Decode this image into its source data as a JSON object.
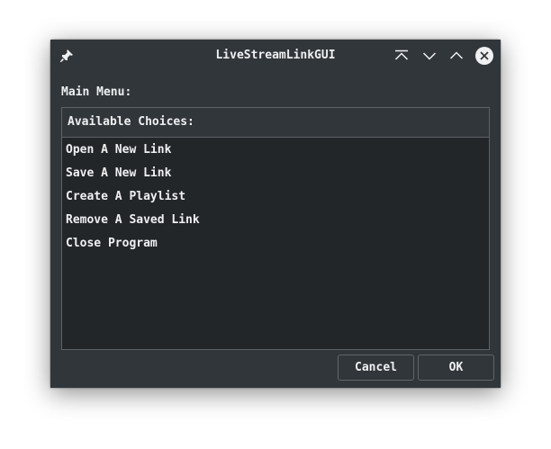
{
  "window": {
    "title": "LiveStreamLinkGUI"
  },
  "titlebar_icons": [
    "pin-icon",
    "keep-above-icon",
    "minimize-icon",
    "maximize-icon",
    "close-icon"
  ],
  "main": {
    "label": "Main Menu:",
    "list_header": "Available Choices:",
    "items": [
      "Open A New Link",
      "Save A New Link",
      "Create A Playlist",
      "Remove A Saved Link",
      "Close Program"
    ]
  },
  "buttons": {
    "cancel": "Cancel",
    "ok": "OK"
  },
  "colors": {
    "window_bg": "#31363b",
    "list_bg": "#232629",
    "text": "#eff0f1",
    "border": "#5d6266"
  }
}
